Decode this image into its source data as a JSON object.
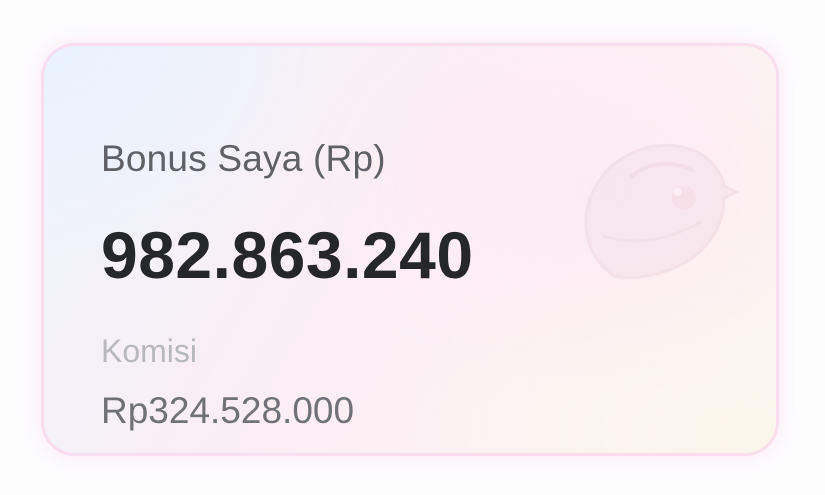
{
  "bonus_card": {
    "title": "Bonus Saya (Rp)",
    "amount": "982.863.240",
    "commission_label": "Komisi",
    "commission_amount": "Rp324.528.000",
    "watermark_icon": "bird-logo-icon",
    "colors": {
      "title": "#5f6166",
      "amount": "#26272b",
      "commission_label": "#b8b9be",
      "commission_amount": "#707277",
      "border": "#fbd6ec"
    }
  }
}
